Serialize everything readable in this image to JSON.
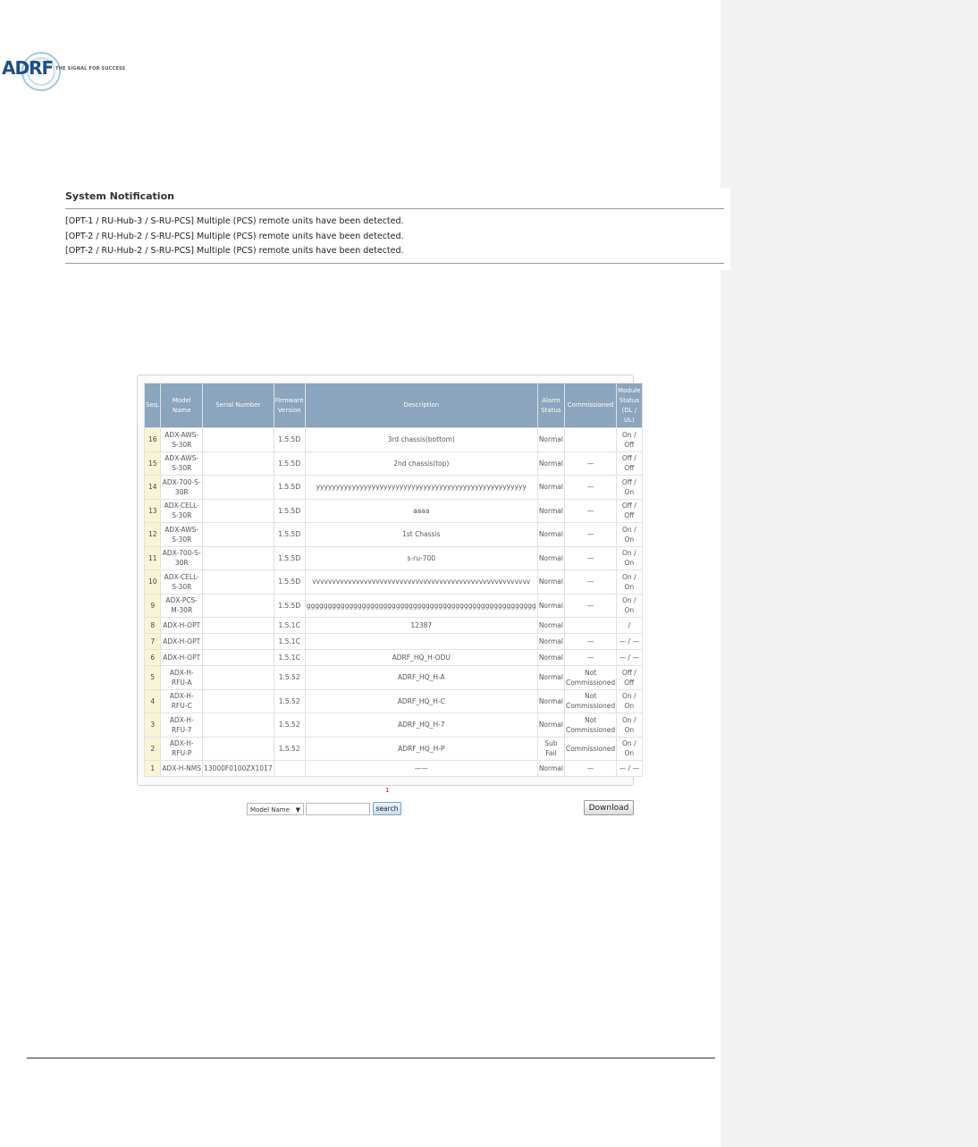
{
  "logo": {
    "letters": "ADRF",
    "tagline": "The signal for success"
  },
  "notification": {
    "title": "System Notification",
    "lines": [
      "[OPT-1 / RU-Hub-3 / S-RU-PCS] Multiple (PCS) remote units have been detected.",
      "[OPT-2 / RU-Hub-2 / S-RU-PCS] Multiple (PCS) remote units have been detected.",
      "[OPT-2 / RU-Hub-2 / S-RU-PCS] Multiple (PCS) remote units have been detected."
    ]
  },
  "table": {
    "headers": {
      "seq": "Seq.",
      "model": "Model Name",
      "serial": "Serial Number",
      "firmware": "Firmware Version",
      "description": "Description",
      "alarm": "Alarm Status",
      "commissioned": "Commissioned",
      "module": "Module Status (DL / UL)"
    },
    "rows": [
      {
        "seq": "16",
        "model": "ADX-AWS-S-30R",
        "serial": "",
        "firmware": "1.5.5D",
        "description": "3rd chassis(bottom)",
        "alarm": "Normal",
        "commissioned": "",
        "module": "On / Off"
      },
      {
        "seq": "15",
        "model": "ADX-AWS-S-30R",
        "serial": "",
        "firmware": "1.5.5D",
        "description": "2nd chassis(top)",
        "alarm": "Normal",
        "commissioned": "—",
        "module": "Off / Off"
      },
      {
        "seq": "14",
        "model": "ADX-700-S-30R",
        "serial": "",
        "firmware": "1.5.5D",
        "description": "yyyyyyyyyyyyyyyyyyyyyyyyyyyyyyyyyyyyyyyyyyyyyyyyyyyyy",
        "alarm": "Normal",
        "commissioned": "—",
        "module": "Off / On"
      },
      {
        "seq": "13",
        "model": "ADX-CELL-S-30R",
        "serial": "",
        "firmware": "1.5.5D",
        "description": "aaaa",
        "alarm": "Normal",
        "commissioned": "—",
        "module": "Off / Off"
      },
      {
        "seq": "12",
        "model": "ADX-AWS-S-30R",
        "serial": "",
        "firmware": "1.5.5D",
        "description": "1st Chassis",
        "alarm": "Normal",
        "commissioned": "—",
        "module": "On / On"
      },
      {
        "seq": "11",
        "model": "ADX-700-S-30R",
        "serial": "",
        "firmware": "1.5.5D",
        "description": "s-ru-700",
        "alarm": "Normal",
        "commissioned": "—",
        "module": "On / On"
      },
      {
        "seq": "10",
        "model": "ADX-CELL-S-30R",
        "serial": "",
        "firmware": "1.5.5D",
        "description": "vvvvvvvvvvvvvvvvvvvvvvvvvvvvvvvvvvvvvvvvvvvvvvvvvvvvvvv",
        "alarm": "Normal",
        "commissioned": "—",
        "module": "On / On"
      },
      {
        "seq": "9",
        "model": "ADX-PCS-M-30R",
        "serial": "",
        "firmware": "1.5.5D",
        "description": "gggggggggggggggggggggggggggggggggggggggggggggggggggggg",
        "alarm": "Normal",
        "commissioned": "—",
        "module": "On / On"
      },
      {
        "seq": "8",
        "model": "ADX-H-OPT",
        "serial": "",
        "firmware": "1.5.1C",
        "description": "12387",
        "alarm": "Normal",
        "commissioned": "",
        "module": "/"
      },
      {
        "seq": "7",
        "model": "ADX-H-OPT",
        "serial": "",
        "firmware": "1.5.1C",
        "description": "",
        "alarm": "Normal",
        "commissioned": "—",
        "module": "— / —"
      },
      {
        "seq": "6",
        "model": "ADX-H-OPT",
        "serial": "",
        "firmware": "1.5.1C",
        "description": "ADRF_HQ_H-ODU",
        "alarm": "Normal",
        "commissioned": "—",
        "module": "— / —"
      },
      {
        "seq": "5",
        "model": "ADX-H-RFU-A",
        "serial": "",
        "firmware": "1.5.52",
        "description": "ADRF_HQ_H-A",
        "alarm": "Normal",
        "commissioned": "Not Commissioned",
        "module": "Off / Off"
      },
      {
        "seq": "4",
        "model": "ADX-H-RFU-C",
        "serial": "",
        "firmware": "1.5.52",
        "description": "ADRF_HQ_H-C",
        "alarm": "Normal",
        "commissioned": "Not Commissioned",
        "module": "On / On"
      },
      {
        "seq": "3",
        "model": "ADX-H-RFU-7",
        "serial": "",
        "firmware": "1.5.52",
        "description": "ADRF_HQ_H-7",
        "alarm": "Normal",
        "commissioned": "Not Commissioned",
        "module": "On / On"
      },
      {
        "seq": "2",
        "model": "ADX-H-RFU-P",
        "serial": "",
        "firmware": "1.5.52",
        "description": "ADRF_HQ_H-P",
        "alarm": "Sub Fail",
        "commissioned": "Commissioned",
        "module": "On / On"
      },
      {
        "seq": "1",
        "model": "ADX-H-NMS",
        "serial": "13000F0100ZX1017",
        "firmware": "",
        "description": "——",
        "alarm": "Normal",
        "commissioned": "—",
        "module": "— / —"
      }
    ]
  },
  "pager": {
    "current": "1"
  },
  "search": {
    "select_label": "Model Name",
    "button": "search"
  },
  "download_label": "Download"
}
